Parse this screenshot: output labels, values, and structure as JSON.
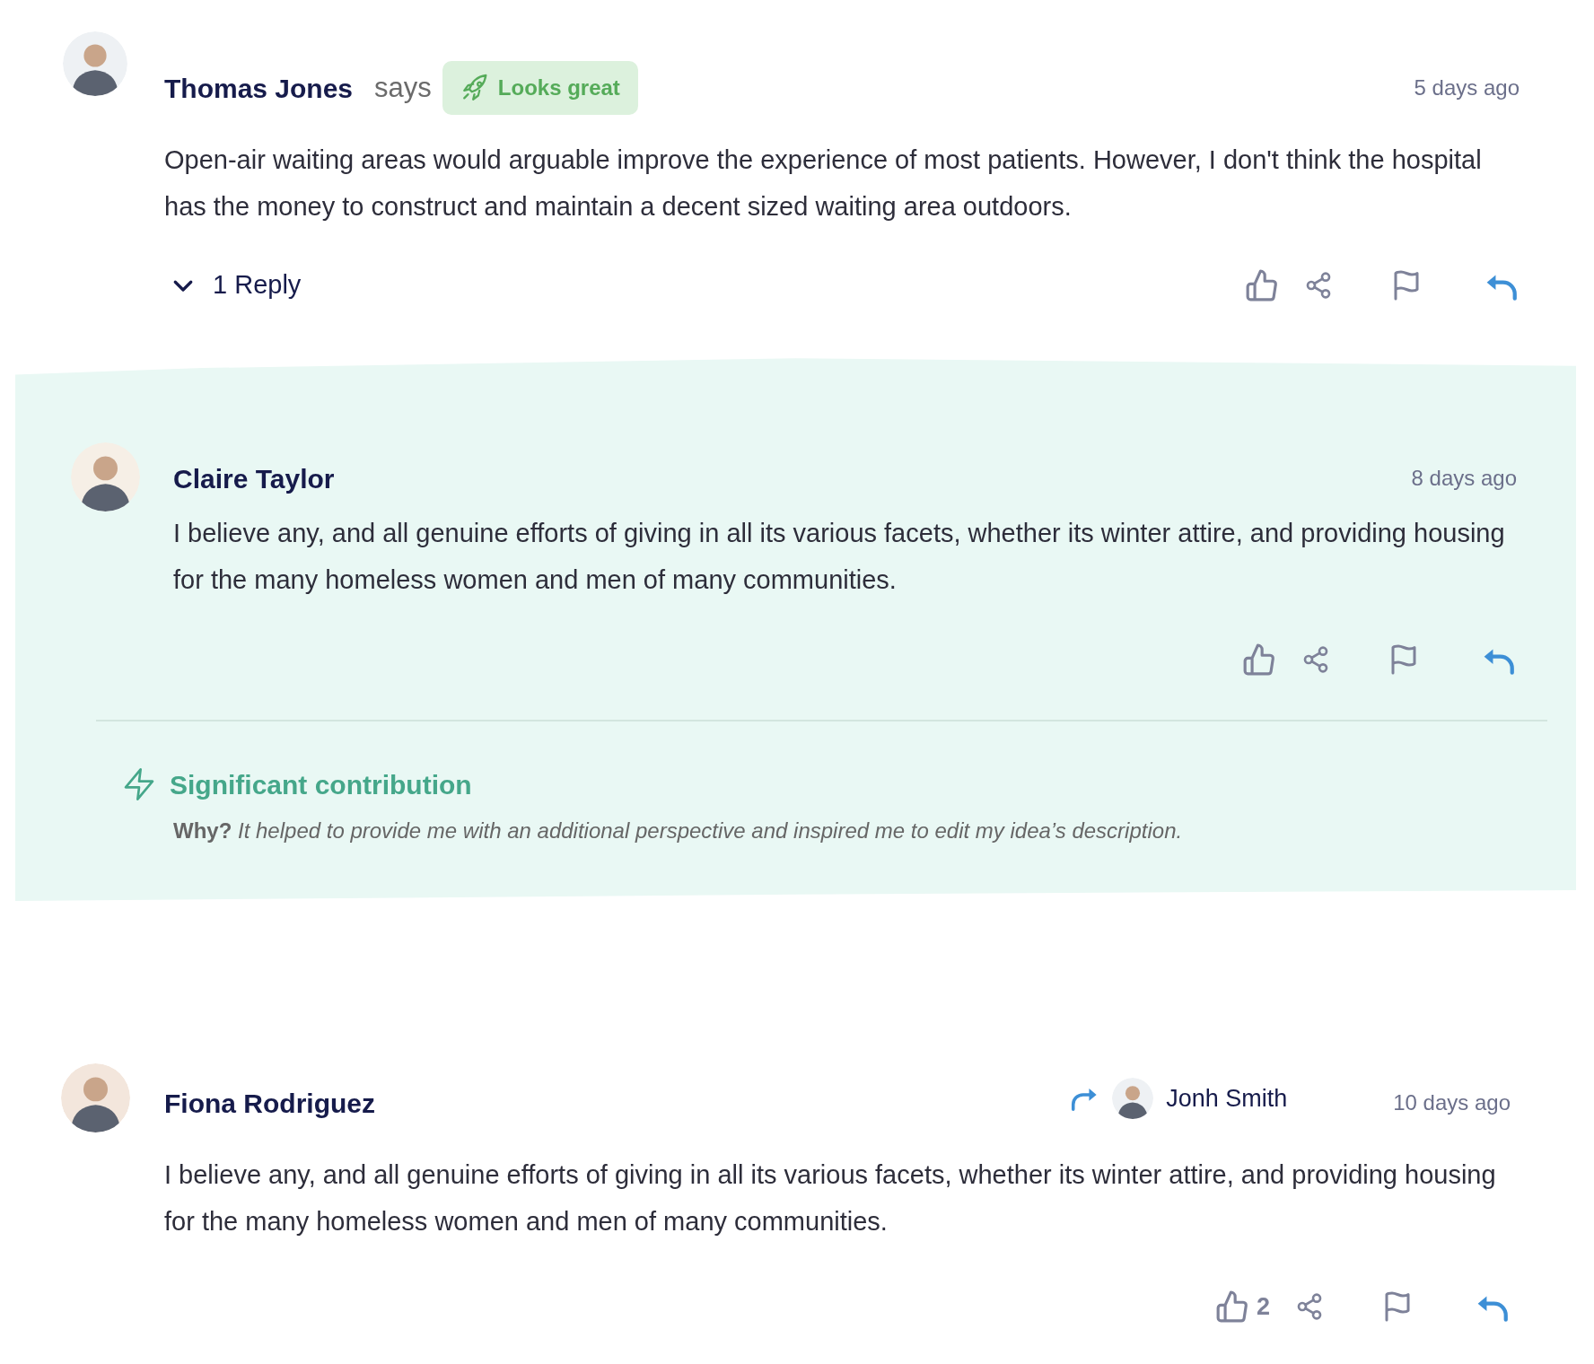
{
  "comments": [
    {
      "author": "Thomas Jones",
      "says": "says",
      "badge": "Looks great",
      "time": "5 days ago",
      "body": "Open-air waiting areas would arguable improve the experience of most patients. However, I don't think the hospital has the money to construct and maintain a decent sized waiting area outdoors.",
      "replies_toggle": {
        "label": "1 Reply",
        "expanded": true
      },
      "replies": [
        {
          "author": "Claire Taylor",
          "time": "8 days ago",
          "body": "I believe any, and all genuine efforts of giving in all its various facets, whether its winter attire, and providing housing for the many homeless women and men of many communities.",
          "highlight": {
            "title": "Significant contribution",
            "why_label": "Why?",
            "why": "It helped to provide me with an additional perspective and inspired me to edit my idea’s description."
          }
        }
      ]
    },
    {
      "author": "Fiona Rodriguez",
      "shared_with": "Jonh Smith",
      "time": "10 days ago",
      "body": "I believe any, and all genuine efforts of giving in all its various facets, whether its winter attire, and providing housing for the many homeless women and men of many communities.",
      "like_count": "2"
    }
  ]
}
